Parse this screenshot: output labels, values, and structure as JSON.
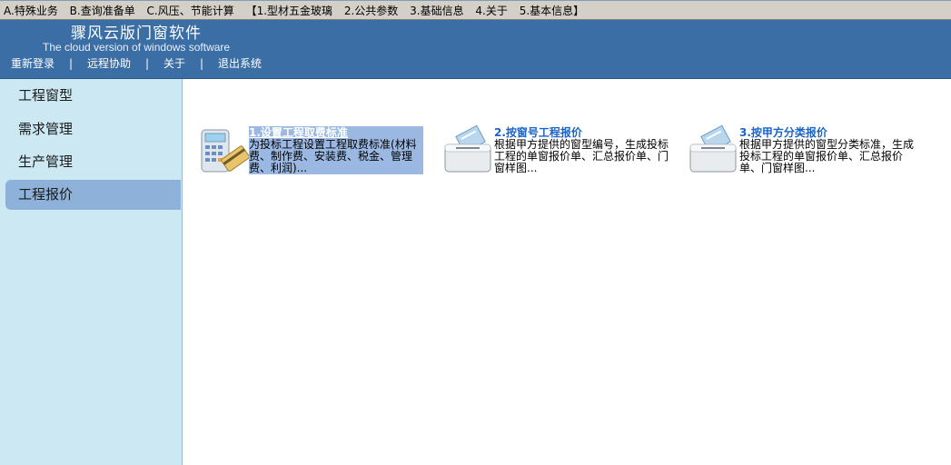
{
  "menubar": {
    "items": [
      "A.特殊业务",
      "B.查询准备单",
      "C.风压、节能计算",
      "【1.型材五金玻璃",
      "2.公共参数",
      "3.基础信息",
      "4.关于",
      "5.基本信息】"
    ]
  },
  "header": {
    "title": "骤风云版门窗软件",
    "subtitle": "The cloud version of windows software",
    "nav": {
      "relogin": "重新登录",
      "remote": "远程协助",
      "about": "关于",
      "exit": "退出系统",
      "separator": "|"
    }
  },
  "sidebar": {
    "items": [
      {
        "label": "工程窗型"
      },
      {
        "label": "需求管理"
      },
      {
        "label": "生产管理"
      },
      {
        "label": "工程报价"
      }
    ],
    "active_index": 3
  },
  "cards": [
    {
      "title": "1.设置工程取费标准",
      "desc": "为投标工程设置工程取费标准(材料费、制作费、安装费、税金、管理费、利润)...",
      "icon": "calculator-icon"
    },
    {
      "title": "2.按窗号工程报价",
      "desc": "根据甲方提供的窗型编号，生成投标工程的单窗报价单、汇总报价单、门窗样图...",
      "icon": "document-tray-icon"
    },
    {
      "title": "3.按甲方分类报价",
      "desc": "根据甲方提供的窗型分类标准，生成投标工程的单窗报价单、汇总报价单、门窗样图...",
      "icon": "document-tray-icon"
    }
  ],
  "colors": {
    "header_bg": "#3b6ea5",
    "sidebar_bg": "#cbe8f3",
    "sidebar_active": "#8eb1d9",
    "card_title": "#1964c8",
    "card_selected_bg": "#9bb8e2"
  }
}
